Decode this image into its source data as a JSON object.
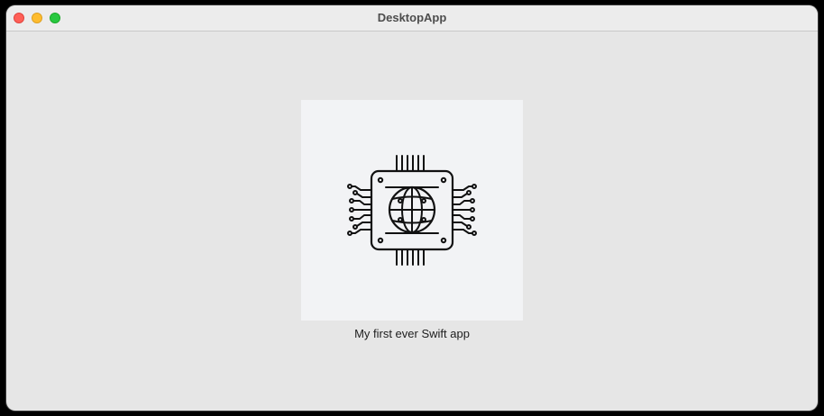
{
  "window": {
    "title": "DesktopApp"
  },
  "content": {
    "image_icon": "chip-globe-icon",
    "caption": "My first ever Swift app"
  },
  "colors": {
    "window_background": "#e6e6e6",
    "titlebar": "#ececec",
    "close": "#ff5f57",
    "minimize": "#febc2e",
    "zoom": "#28c840",
    "image_background": "#f2f3f5"
  }
}
